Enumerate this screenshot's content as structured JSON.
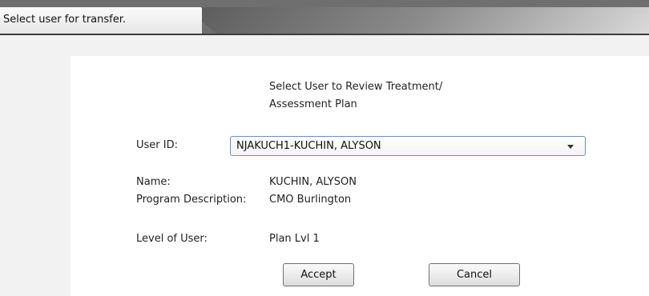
{
  "window": {
    "title": "Select user for transfer."
  },
  "dialog": {
    "heading_line1": "Select User to Review Treatment/",
    "heading_line2": "Assessment Plan",
    "user_id_label": "User ID:",
    "user_id_selected": "NJAKUCH1-KUCHIN, ALYSON",
    "name_label": "Name:",
    "name_value": "KUCHIN, ALYSON",
    "program_label": "Program Description:",
    "program_value": "CMO Burlington",
    "level_label": "Level of User:",
    "level_value": "Plan Lvl 1",
    "accept_label": "Accept",
    "cancel_label": "Cancel"
  },
  "icons": {
    "dropdown": "chevron-down-icon"
  }
}
